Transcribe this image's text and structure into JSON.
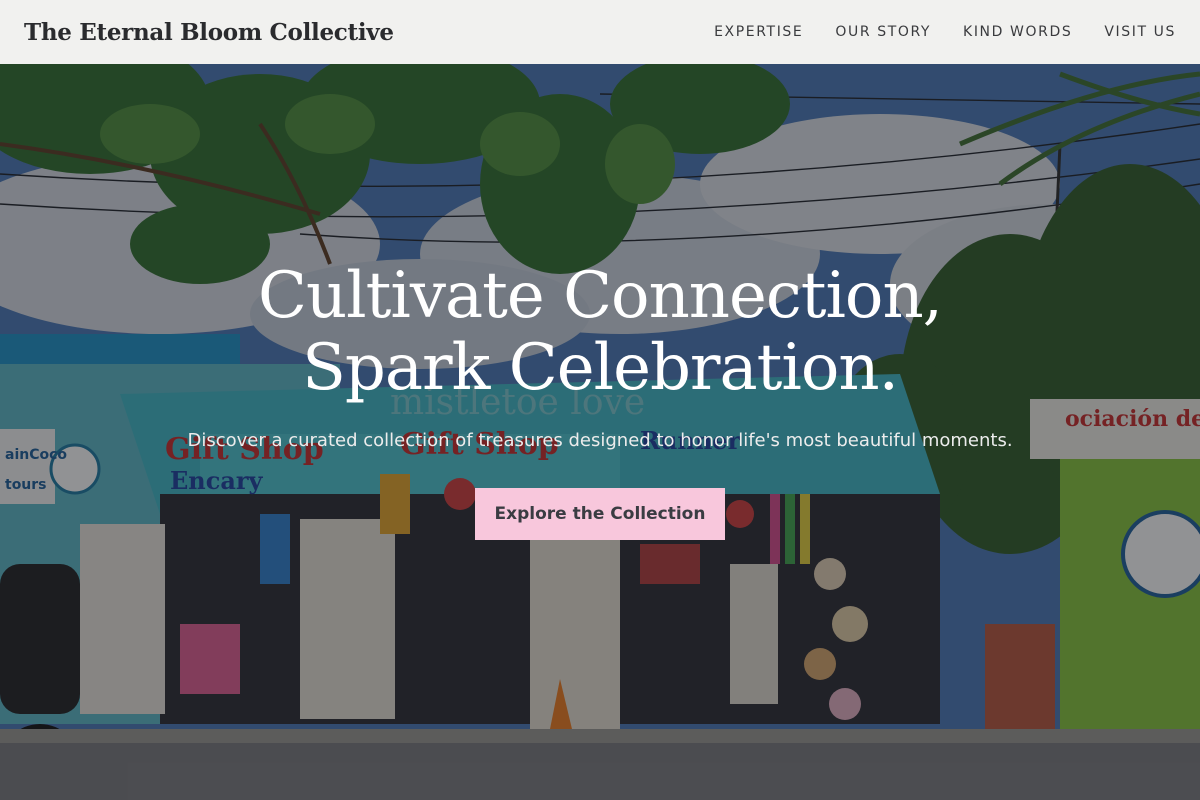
{
  "header": {
    "brand": "The Eternal Bloom Collective",
    "nav": [
      "EXPERTISE",
      "OUR STORY",
      "KIND WORDS",
      "VISIT US"
    ]
  },
  "hero": {
    "title_line1": "Cultivate Connection,",
    "title_line2": "Spark Celebration.",
    "subtitle": "Discover a curated collection of treasures designed to honor life's most beautiful moments.",
    "cta_label": "Explore the Collection",
    "background": {
      "store_signs": [
        "Gift Shop",
        "Encary",
        "Gift Shop",
        "Runner",
        "ainCoco",
        "tours",
        "ociación de tr",
        "mistletoe love"
      ],
      "colors": {
        "sky": "#3f6fb3",
        "storefront": "#35b5c4",
        "kiosk": "#8cc83b",
        "accent_pink": "#f8c7dc"
      }
    }
  }
}
